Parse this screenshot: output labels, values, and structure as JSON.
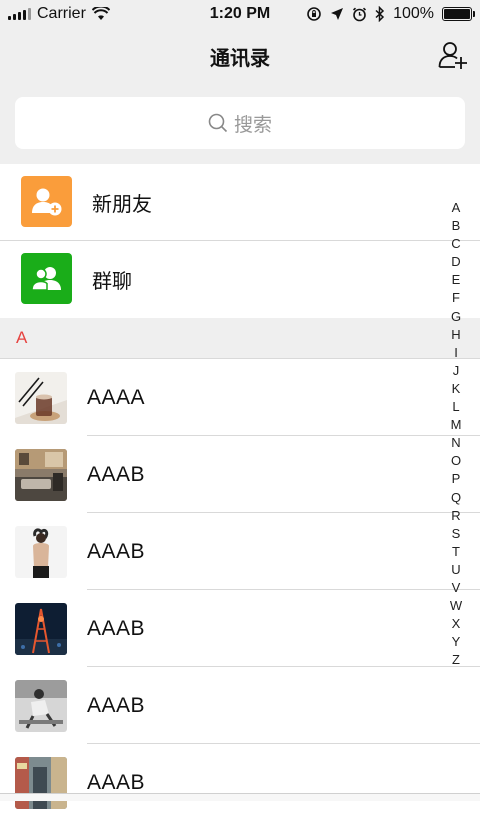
{
  "status_bar": {
    "carrier": "Carrier",
    "time": "1:20 PM",
    "battery": "100%"
  },
  "navbar": {
    "title": "通讯录"
  },
  "search": {
    "placeholder": "搜索"
  },
  "fixed_items": [
    {
      "label": "新朋友",
      "icon": "add-friend-icon",
      "color": "#fa9d3b"
    },
    {
      "label": "群聊",
      "icon": "group-chat-icon",
      "color": "#1aad19"
    }
  ],
  "section": {
    "letter": "A",
    "color": "#e64340"
  },
  "contacts": [
    {
      "name": "AAAA",
      "avatar": "coffee-cup-photo"
    },
    {
      "name": "AAAB",
      "avatar": "living-room-photo"
    },
    {
      "name": "AAAB",
      "avatar": "person-back-photo"
    },
    {
      "name": "AAAB",
      "avatar": "night-tower-photo"
    },
    {
      "name": "AAAB",
      "avatar": "bw-person-photo"
    },
    {
      "name": "AAAB",
      "avatar": "street-photo"
    }
  ],
  "index_letters": [
    "A",
    "B",
    "C",
    "D",
    "E",
    "F",
    "G",
    "H",
    "I",
    "J",
    "K",
    "L",
    "M",
    "N",
    "O",
    "P",
    "Q",
    "R",
    "S",
    "T",
    "U",
    "V",
    "W",
    "X",
    "Y",
    "Z"
  ]
}
